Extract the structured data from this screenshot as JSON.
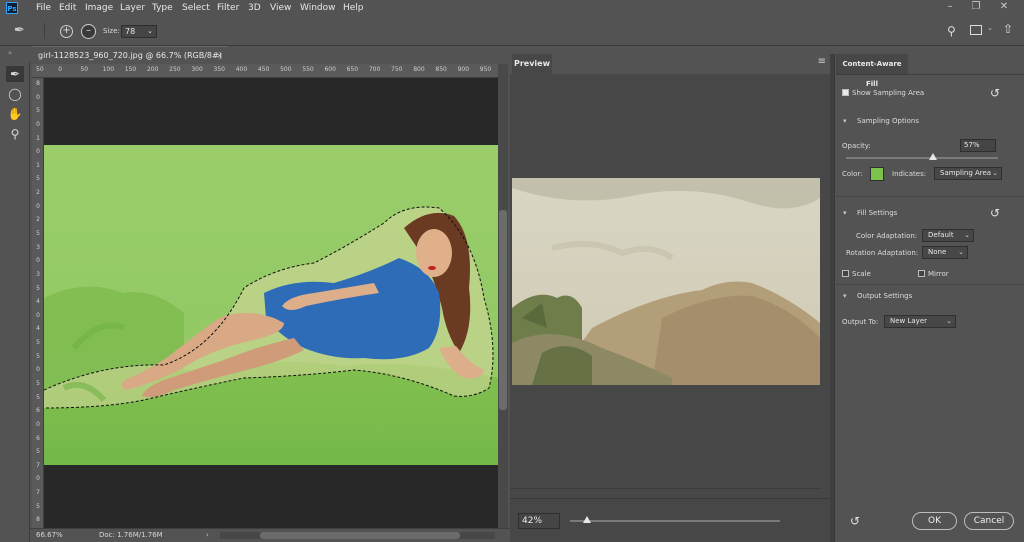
{
  "menubar": {
    "app_icon": "Ps",
    "items": [
      "File",
      "Edit",
      "Image",
      "Layer",
      "Type",
      "Select",
      "Filter",
      "3D",
      "View",
      "Window",
      "Help"
    ],
    "window_controls": [
      "minimize-icon",
      "restore-icon",
      "close-icon"
    ]
  },
  "options": {
    "size_label": "Size:",
    "size_value": "78",
    "add_icon": "circle-plus-icon",
    "subtract_icon": "circle-minus-icon"
  },
  "toolbar": {
    "tools": [
      "sampling-brush-icon",
      "lasso-icon",
      "hand-icon",
      "zoom-icon"
    ]
  },
  "document": {
    "tab_title": "girl-1128523_960_720.jpg @ 66.7% (RGB/8#)",
    "ruler_top": [
      "50",
      "0",
      "50",
      "100",
      "150",
      "200",
      "250",
      "300",
      "350",
      "400",
      "450",
      "500",
      "550",
      "600",
      "650",
      "700",
      "750",
      "800",
      "850",
      "900",
      "950"
    ],
    "ruler_left": [
      "8",
      "0",
      "5",
      "0",
      "1",
      "0",
      "1",
      "5",
      "2",
      "0",
      "2",
      "5",
      "3",
      "0",
      "3",
      "5",
      "4",
      "0",
      "4",
      "5",
      "5",
      "0",
      "5",
      "5",
      "6",
      "0",
      "6",
      "5",
      "7",
      "0",
      "7",
      "5",
      "8"
    ]
  },
  "status": {
    "zoom": "66.67%",
    "doc_info": "Doc: 1.76M/1.76M"
  },
  "preview": {
    "tab_label": "Preview",
    "zoom_value": "42%",
    "zoom_fraction": 0.08
  },
  "panel": {
    "tab_label": "Content-Aware Fill",
    "show_sampling_area": "Show Sampling Area",
    "sampling_options": "Sampling Options",
    "opacity_label": "Opacity:",
    "opacity_value": "57%",
    "opacity_fraction": 0.57,
    "color_label": "Color:",
    "color_swatch": "#7dc24b",
    "indicates_label": "Indicates:",
    "indicates_value": "Sampling Area",
    "fill_settings": "Fill Settings",
    "color_adaptation_label": "Color Adaptation:",
    "color_adaptation_value": "Default",
    "rotation_adaptation_label": "Rotation Adaptation:",
    "rotation_adaptation_value": "None",
    "scale_label": "Scale",
    "mirror_label": "Mirror",
    "output_settings": "Output Settings",
    "output_to_label": "Output To:",
    "output_to_value": "New Layer",
    "ok_label": "OK",
    "cancel_label": "Cancel"
  }
}
